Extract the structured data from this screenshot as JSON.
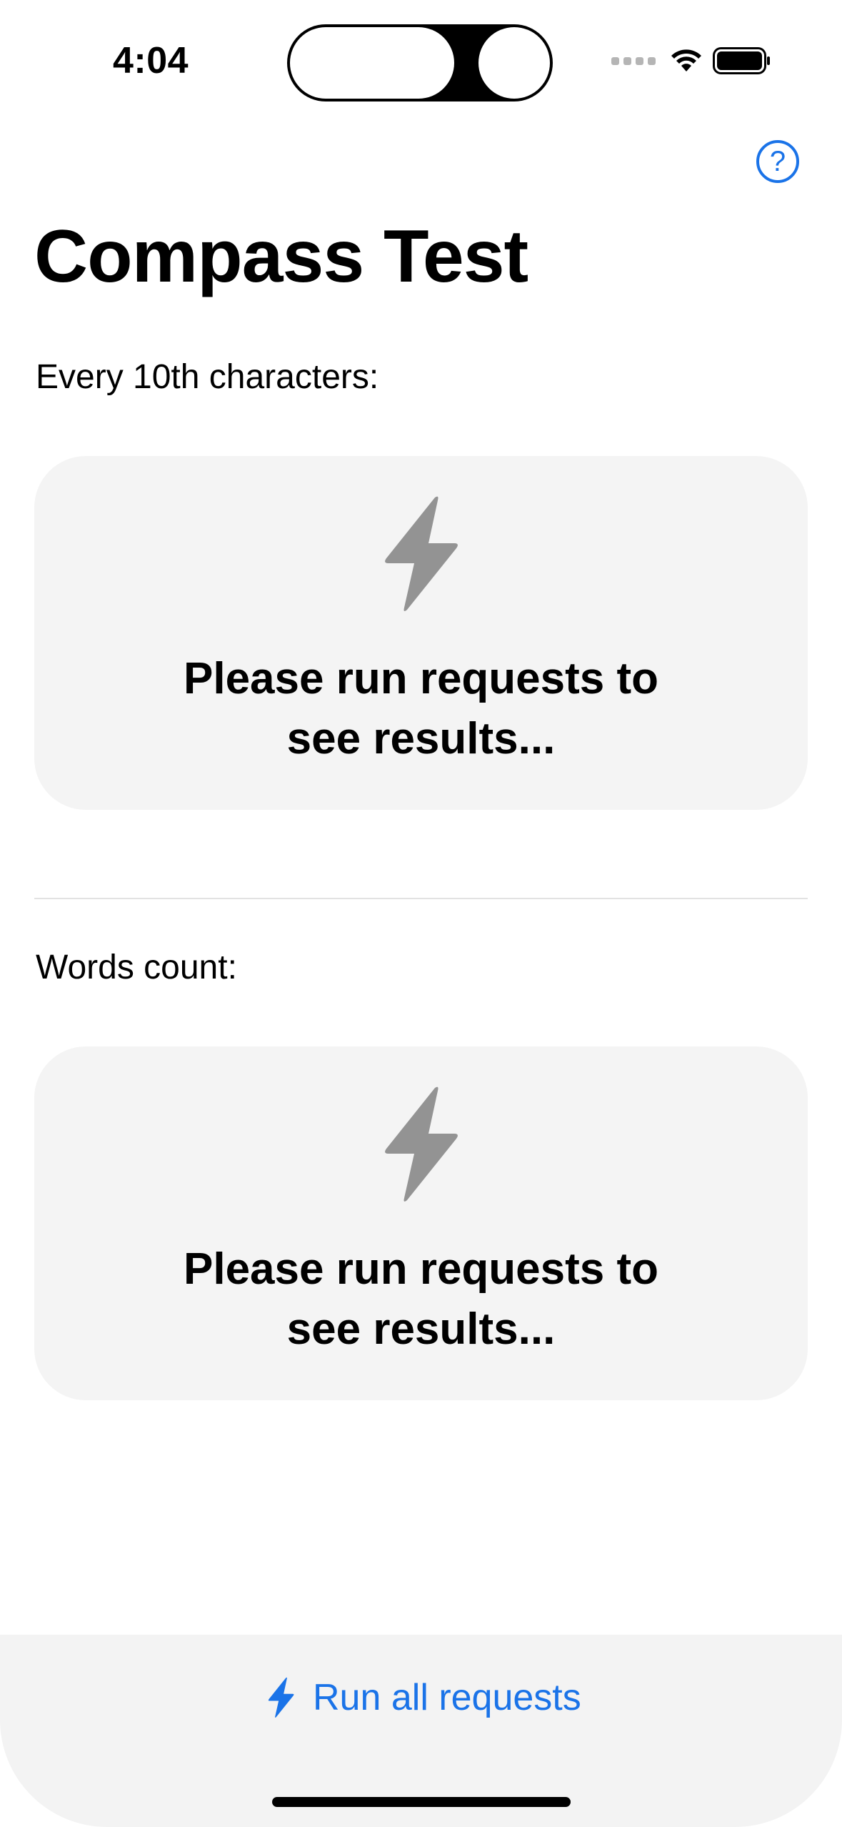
{
  "status_bar": {
    "time": "4:04",
    "icons": [
      "cellular-signal-icon",
      "wifi-icon",
      "battery-icon"
    ]
  },
  "header": {
    "help_icon": "question-mark-circle-icon",
    "help_glyph": "?",
    "title": "Compass Test"
  },
  "sections": [
    {
      "label": "Every 10th characters:",
      "card": {
        "icon": "lightning-bolt-icon",
        "message": "Please run requests to see results..."
      }
    },
    {
      "label": "Words count:",
      "card": {
        "icon": "lightning-bolt-icon",
        "message": "Please run requests to see results..."
      }
    }
  ],
  "bottom_bar": {
    "button_icon": "lightning-bolt-icon",
    "button_label": "Run all requests"
  },
  "colors": {
    "accent": "#1a73e8",
    "card_background": "#f4f4f4",
    "icon_gray": "#939393"
  }
}
